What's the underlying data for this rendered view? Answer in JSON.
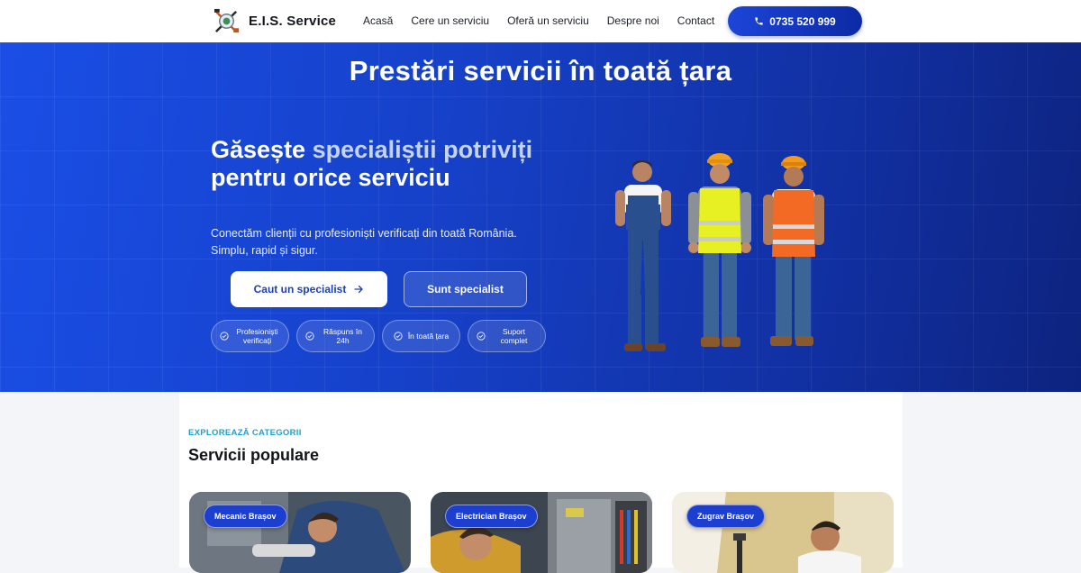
{
  "brand": {
    "name": "E.I.S. Service",
    "logo_icon": "tools-emblem-icon"
  },
  "nav": {
    "items": [
      "Acasă",
      "Cere un serviciu",
      "Oferă un serviciu",
      "Despre noi",
      "Contact"
    ],
    "phone": "0735 520 999",
    "phone_icon": "phone-icon"
  },
  "hero": {
    "banner": "Prestări servicii în toată țara",
    "heading_part1": "Găsește ",
    "heading_highlight": "specialiștii potriviți",
    "heading_part2": " pentru orice serviciu",
    "subtitle": "Conectăm clienții cu profesioniști verificați din toată România. Simplu, rapid și sigur.",
    "primary_button": "Caut un specialist",
    "secondary_button": "Sunt specialist",
    "badges": [
      "Profesioniști verificați",
      "Răspuns în 24h",
      "În toată țara",
      "Suport complet"
    ],
    "colors": {
      "primary": "#1a4ee6",
      "dark": "#0d237f"
    }
  },
  "section": {
    "eyebrow": "EXPLOREAZĂ CATEGORII",
    "title": "Servicii populare",
    "cards": [
      {
        "tag": "Mecanic Brașov"
      },
      {
        "tag": "Electrician Brașov"
      },
      {
        "tag": "Zugrav Brașov"
      }
    ]
  }
}
